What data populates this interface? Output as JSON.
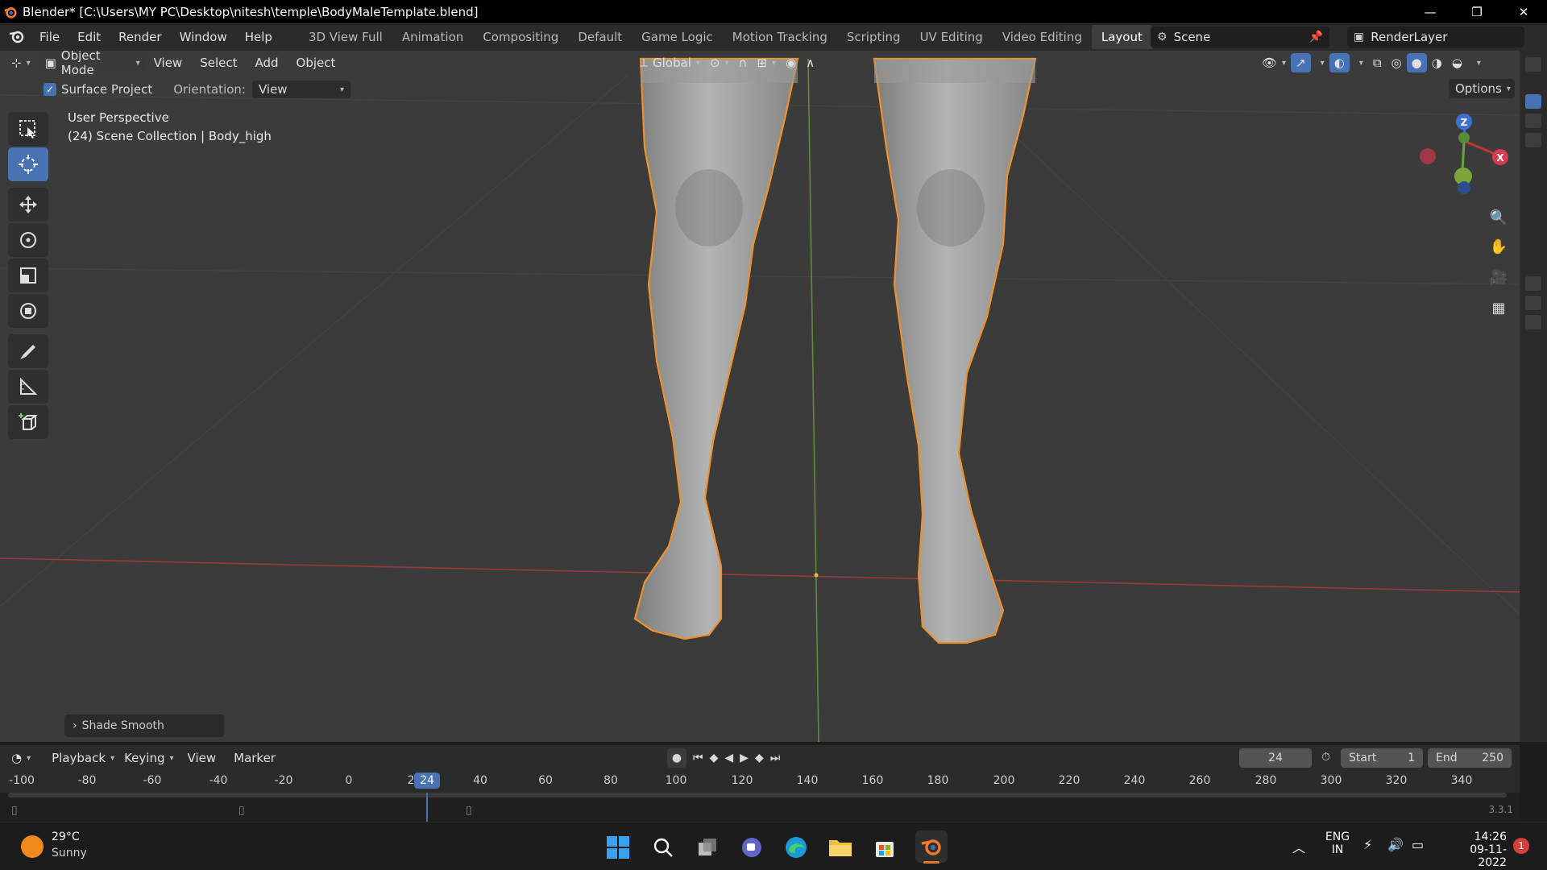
{
  "window": {
    "title": "Blender* [C:\\Users\\MY PC\\Desktop\\nitesh\\temple\\BodyMaleTemplate.blend]",
    "controls": [
      "—",
      "❐",
      "✕"
    ]
  },
  "menu": [
    "File",
    "Edit",
    "Render",
    "Window",
    "Help"
  ],
  "workspaces": {
    "tabs": [
      "3D View Full",
      "Animation",
      "Compositing",
      "Default",
      "Game Logic",
      "Motion Tracking",
      "Scripting",
      "UV Editing",
      "Video Editing",
      "Layout"
    ],
    "active": "Layout",
    "add": "+"
  },
  "scene": {
    "label": "Scene",
    "render_layer": "RenderLayer"
  },
  "viewport_header": {
    "mode": "Object Mode",
    "menus": [
      "View",
      "Select",
      "Add",
      "Object"
    ],
    "transform_orientation": "Global",
    "options_label": "Options"
  },
  "tool_settings": {
    "surface_project_label": "Surface Project",
    "surface_project_checked": true,
    "orientation_label": "Orientation:",
    "orientation_value": "View"
  },
  "viewport": {
    "perspective_label": "User Perspective",
    "collection_label": "(24) Scene Collection | Body_high",
    "last_op": "Shade Smooth",
    "gizmo": {
      "z": "Z",
      "x": "X"
    }
  },
  "timeline": {
    "menus": [
      "Playback",
      "Keying",
      "View",
      "Marker"
    ],
    "current_frame": "24",
    "start_label": "Start",
    "start": "1",
    "end_label": "End",
    "end": "250",
    "ruler": [
      "-100",
      "-80",
      "-60",
      "-40",
      "-20",
      "0",
      "2",
      "40",
      "60",
      "80",
      "100",
      "120",
      "140",
      "160",
      "180",
      "200",
      "220",
      "240",
      "260",
      "280",
      "300",
      "320",
      "340"
    ],
    "playhead": "24",
    "version": "3.3.1"
  },
  "taskbar": {
    "weather_temp": "29°C",
    "weather_desc": "Sunny",
    "lang_top": "ENG",
    "lang_bottom": "IN",
    "time": "14:26",
    "date": "09-11-2022",
    "notif_count": "1"
  },
  "colors": {
    "accent": "#4772b3",
    "selection_outline": "#f0912b",
    "x_axis": "#c0392b",
    "y_axis": "#6aa23e"
  }
}
